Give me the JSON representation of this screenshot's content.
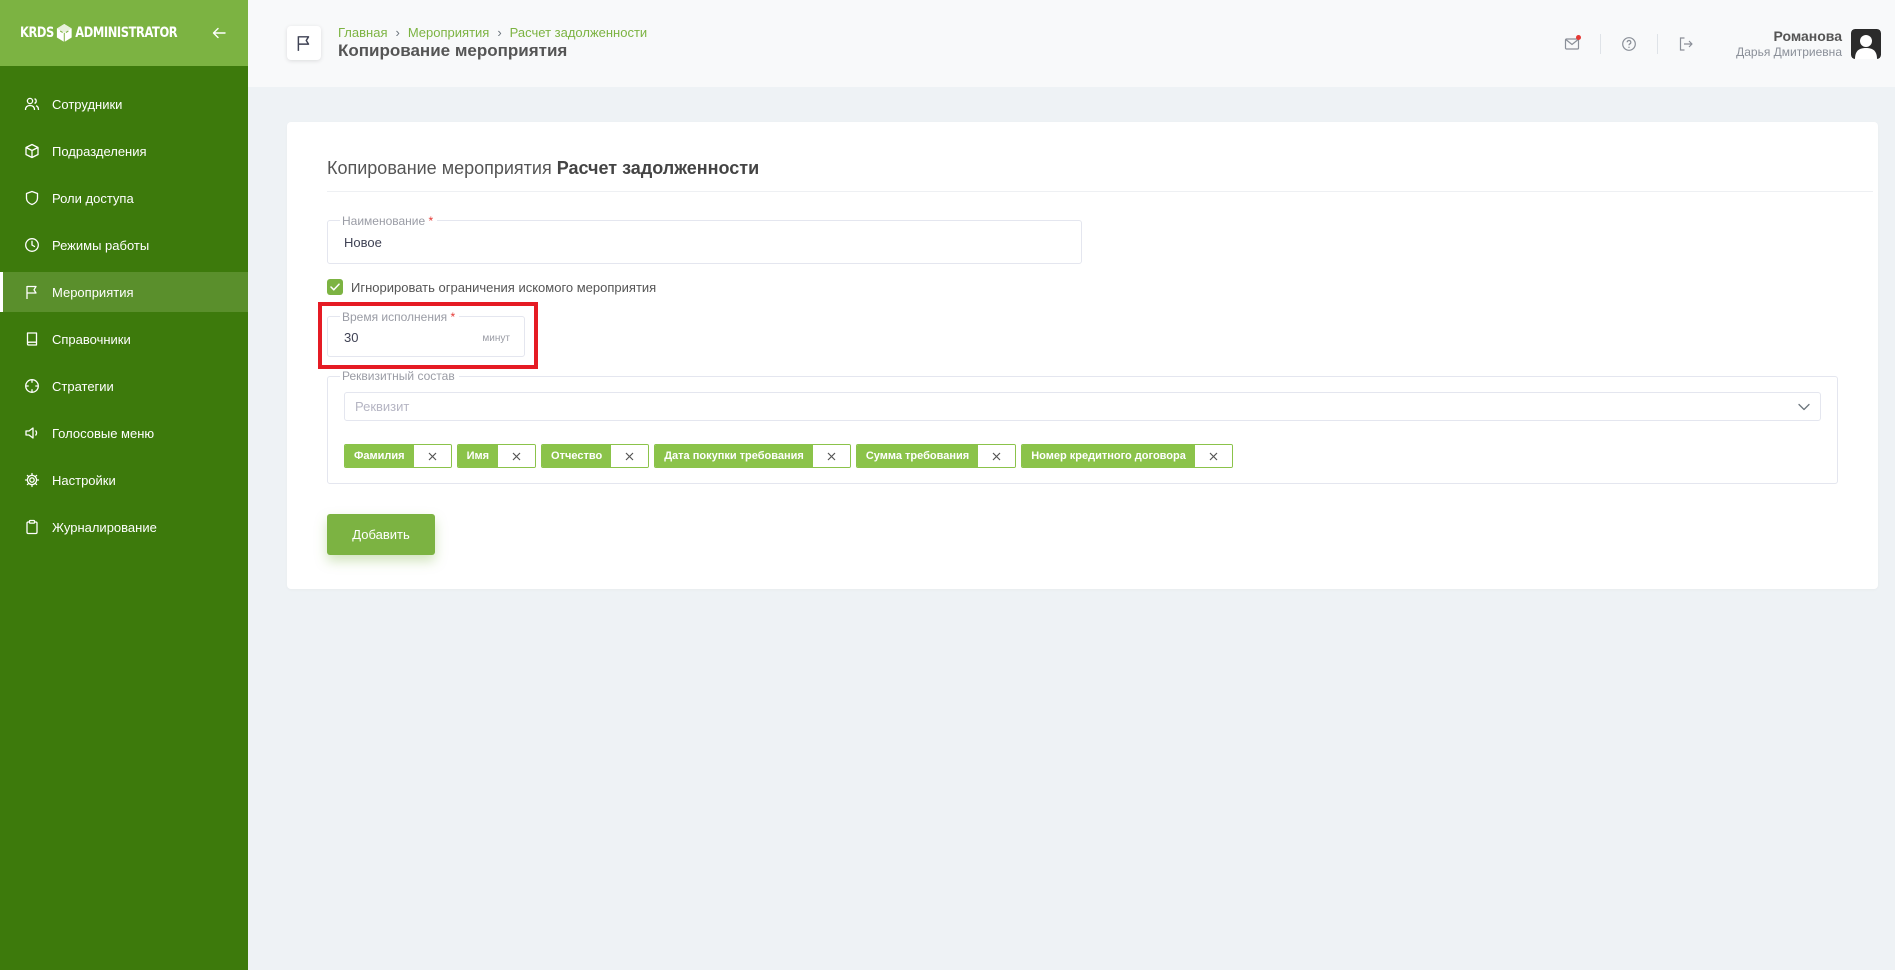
{
  "sidebar": {
    "logo_left": "KRDS",
    "logo_right": "ADMINISTRATOR",
    "items": [
      {
        "label": "Сотрудники",
        "icon": "users-icon"
      },
      {
        "label": "Подразделения",
        "icon": "box-icon"
      },
      {
        "label": "Роли доступа",
        "icon": "shield-icon"
      },
      {
        "label": "Режимы работы",
        "icon": "clock-icon"
      },
      {
        "label": "Мероприятия",
        "icon": "flag-icon",
        "active": true
      },
      {
        "label": "Справочники",
        "icon": "book-icon"
      },
      {
        "label": "Стратегии",
        "icon": "crosshair-icon"
      },
      {
        "label": "Голосовые меню",
        "icon": "speaker-icon"
      },
      {
        "label": "Настройки",
        "icon": "gear-icon"
      },
      {
        "label": "Журналирование",
        "icon": "clipboard-icon"
      }
    ]
  },
  "header": {
    "breadcrumbs": [
      "Главная",
      "Мероприятия",
      "Расчет задолженности"
    ],
    "title": "Копирование мероприятия",
    "user_name": "Романова",
    "user_subtitle": "Дарья Дмитриевна"
  },
  "form": {
    "title_prefix": "Копирование мероприятия",
    "title_strong": "Расчет задолженности",
    "name_label": "Наименование",
    "name_value": "Новое",
    "ignore_label": "Игнорировать ограничения искомого мероприятия",
    "ignore_checked": true,
    "time_label": "Время исполнения",
    "time_value": "30",
    "time_unit": "минут",
    "requisites_label": "Реквизитный состав",
    "requisite_placeholder": "Реквизит",
    "tags": [
      "Фамилия",
      "Имя",
      "Отчество",
      "Дата покупки требования",
      "Сумма требования",
      "Номер кредитного договора"
    ],
    "submit_label": "Добавить"
  },
  "colors": {
    "sidebar": "#3d7a0c",
    "accent": "#7cb342",
    "highlight": "#e51b24"
  }
}
